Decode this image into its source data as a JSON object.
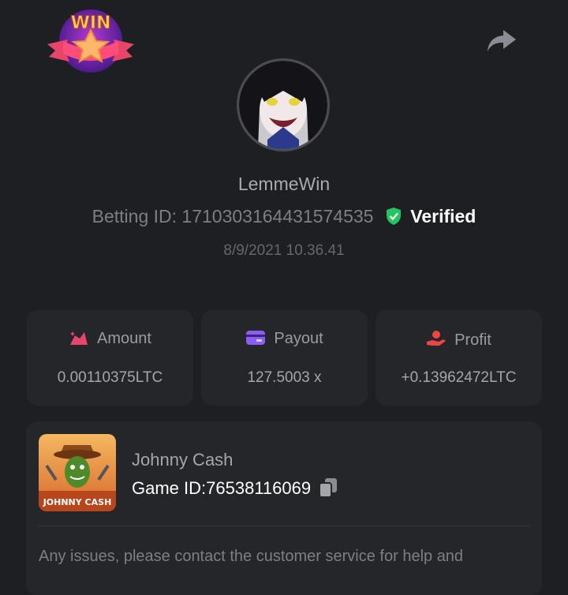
{
  "header": {
    "badge_text": "WIN",
    "share_icon": "share-arrow-icon"
  },
  "profile": {
    "username": "LemmeWin",
    "betting_id_label": "Betting ID: 1710303164431574535",
    "verified_label": "Verified",
    "date": "8/9/2021 10.36.41",
    "verified_color": "#22c55e"
  },
  "stats": [
    {
      "label": "Amount",
      "value": "0.00110375LTC",
      "icon": "amount-icon",
      "color": "#e8456b"
    },
    {
      "label": "Payout",
      "value": "127.5003 x",
      "icon": "wallet-card-icon",
      "color": "#8b5cf6"
    },
    {
      "label": "Profit",
      "value": "+0.13962472LTC",
      "icon": "profit-hand-icon",
      "color": "#ef4444"
    }
  ],
  "game": {
    "name": "Johnny Cash",
    "id_label": "Game ID:",
    "id_value": "76538116069",
    "thumbnail_caption": "JOHNNY CASH"
  },
  "notice": "Any issues, please contact the customer service for help and"
}
